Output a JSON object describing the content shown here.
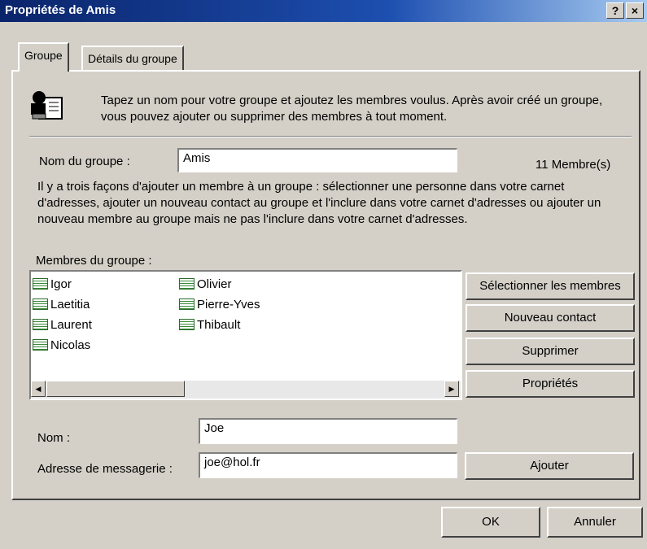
{
  "window": {
    "title": "Propriétés de Amis",
    "help_label": "?",
    "close_label": "×"
  },
  "tabs": [
    "Groupe",
    "Détails du groupe"
  ],
  "intro_text": "Tapez un nom pour votre groupe et ajoutez les membres voulus. Après avoir créé un groupe, vous pouvez ajouter ou supprimer des membres à tout moment.",
  "group_name": {
    "label": "Nom du groupe :",
    "value": "Amis"
  },
  "member_count": "11 Membre(s)",
  "explanation": "Il y a trois façons d'ajouter un membre à un groupe : sélectionner une personne dans votre carnet d'adresses, ajouter un nouveau contact au groupe et l'inclure dans votre carnet d'adresses ou ajouter un nouveau membre au groupe mais ne pas l'inclure dans votre carnet d'adresses.",
  "members_label": "Membres du groupe :",
  "members_col1": [
    "Igor",
    "Laetitia",
    "Laurent",
    "Nicolas"
  ],
  "members_col2": [
    "Olivier",
    "Pierre-Yves",
    "Thibault"
  ],
  "side_buttons": [
    "Sélectionner les membres",
    "Nouveau contact",
    "Supprimer",
    "Propriétés"
  ],
  "name_field": {
    "label": "Nom :",
    "value": "Joe"
  },
  "email_field": {
    "label": "Adresse de messagerie :",
    "value": "joe@hol.fr"
  },
  "add_button": "Ajouter",
  "ok_button": "OK",
  "cancel_button": "Annuler",
  "scrollbar": {
    "left_arrow": "◀",
    "right_arrow": "▶"
  }
}
